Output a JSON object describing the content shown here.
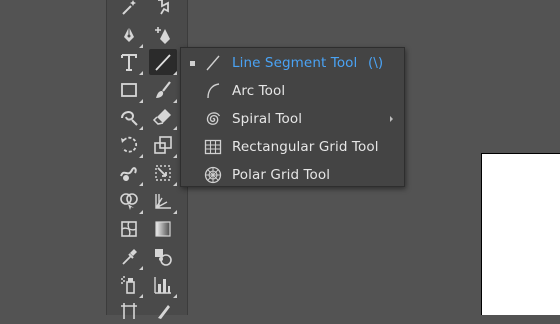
{
  "flyout": {
    "items": [
      {
        "label": "Line Segment Tool",
        "shortcut": "(\\)",
        "selected": true,
        "icon": "line-segment-icon"
      },
      {
        "label": "Arc Tool",
        "shortcut": "",
        "icon": "arc-icon"
      },
      {
        "label": "Spiral Tool",
        "shortcut": "",
        "icon": "spiral-icon"
      },
      {
        "label": "Rectangular Grid Tool",
        "shortcut": "",
        "icon": "rectangular-grid-icon"
      },
      {
        "label": "Polar Grid Tool",
        "shortcut": "",
        "icon": "polar-grid-icon"
      }
    ]
  },
  "colors": {
    "canvas_bg": "#535353",
    "toolbar_bg": "#4a4a4a",
    "flyout_bg": "#444444",
    "accent": "#4aa3f5",
    "icon": "#d6d6d6"
  }
}
